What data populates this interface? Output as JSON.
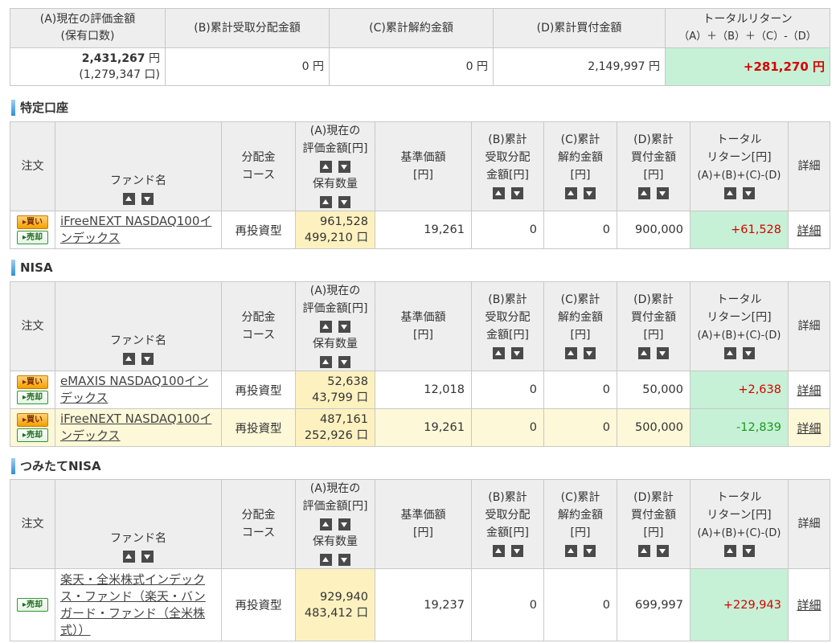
{
  "summary": {
    "headers": [
      "(A)現在の評価金額",
      "(保有口数)",
      "(B)累計受取分配金額",
      "(C)累計解約金額",
      "(D)累計買付金額",
      "トータルリターン",
      "（A）＋（B）＋（C）-（D）"
    ],
    "eval_amount": "2,431,267",
    "units": "(1,279,347 口)",
    "yen": "円",
    "dividend": "0 円",
    "cancel": "0 円",
    "purchase": "2,149,997 円",
    "total_return": "+281,270 円"
  },
  "table_headers": {
    "order": "注文",
    "fund": "ファンド名",
    "course": [
      "分配金",
      "コース"
    ],
    "eval": [
      "(A)現在の",
      "評価金額[円]",
      "保有数量"
    ],
    "nav": [
      "基準価額",
      "[円]"
    ],
    "dividend": [
      "(B)累計",
      "受取分配",
      "金額[円]"
    ],
    "cancel": [
      "(C)累計",
      "解約金額",
      "[円]"
    ],
    "purchase": [
      "(D)累計",
      "買付金額",
      "[円]"
    ],
    "return": [
      "トータル",
      "リターン[円]",
      "(A)+(B)+(C)-(D)"
    ],
    "detail": "詳細"
  },
  "buttons": {
    "buy": "▸買い",
    "sell": "▸売却"
  },
  "sections": [
    {
      "title": "特定口座",
      "rows": [
        {
          "fund": "iFreeNEXT NASDAQ100インデックス",
          "course": "再投資型",
          "eval": "961,528",
          "units": "499,210 口",
          "nav": "19,261",
          "dividend": "0",
          "cancel": "0",
          "purchase": "900,000",
          "return": "+61,528",
          "detail": "詳細"
        }
      ]
    },
    {
      "title": "NISA",
      "rows": [
        {
          "fund": "eMAXIS NASDAQ100インデックス",
          "course": "再投資型",
          "eval": "52,638",
          "units": "43,799 口",
          "nav": "12,018",
          "dividend": "0",
          "cancel": "0",
          "purchase": "50,000",
          "return": "+2,638",
          "detail": "詳細"
        },
        {
          "fund": "iFreeNEXT NASDAQ100インデックス",
          "course": "再投資型",
          "eval": "487,161",
          "units": "252,926 口",
          "nav": "19,261",
          "dividend": "0",
          "cancel": "0",
          "purchase": "500,000",
          "return": "-12,839",
          "detail": "詳細"
        }
      ]
    },
    {
      "title": "つみたてNISA",
      "rows": [
        {
          "fund": "楽天・全米株式インデックス・ファンド（楽天・バンガード・ファンド（全米株式））",
          "course": "再投資型",
          "eval": "929,940",
          "units": "483,412 口",
          "nav": "19,237",
          "dividend": "0",
          "cancel": "0",
          "purchase": "699,997",
          "return": "+229,943",
          "detail": "詳細"
        }
      ]
    }
  ],
  "colors": {
    "return_bg": "#c6f1d6",
    "eval_bg": "#fdf1c0",
    "positive": "#d90000",
    "negative": "#1a9a1a",
    "header_bg": "#eeeeee"
  }
}
